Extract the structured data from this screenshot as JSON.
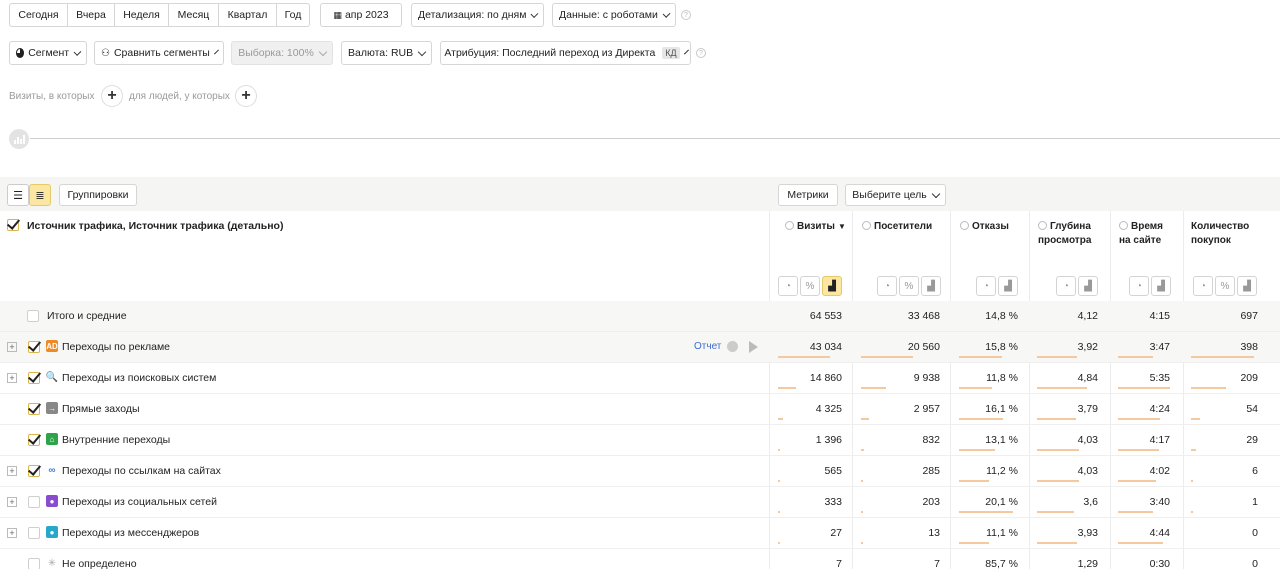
{
  "period_buttons": [
    "Сегодня",
    "Вчера",
    "Неделя",
    "Месяц",
    "Квартал",
    "Год"
  ],
  "date_picker": "апр 2023",
  "detail_label": "Детализация: по дням",
  "data_label": "Данные: с роботами",
  "segment_label": "Сегмент",
  "compare_label": "Сравнить сегменты",
  "sample_label": "Выборка: 100%",
  "currency_label": "Валюта: RUB",
  "attribution_label": "Атрибуция: Последний переход из Директа",
  "attribution_badge": "КД",
  "filter_visits": "Визиты, в которых",
  "filter_people": "для людей, у которых",
  "groupings_label": "Группировки",
  "metrics_label": "Метрики",
  "goal_label": "Выберите цель",
  "table": {
    "dimension_header": "Источник трафика, Источник трафика (детально)",
    "columns": [
      {
        "name": "Визиты",
        "sorted": true
      },
      {
        "name": "Посетители"
      },
      {
        "name": "Отказы"
      },
      {
        "name": "Глубина просмотра",
        "l1": "Глубина",
        "l2": "просмотра"
      },
      {
        "name": "Время на сайте",
        "l1": "Время",
        "l2": "на сайте"
      },
      {
        "name": "Количество покупок",
        "l1": "Количество",
        "l2": "покупок"
      }
    ],
    "sort_marker": "▼",
    "totals": {
      "label": "Итого и средние",
      "values": [
        "64 553",
        "33 468",
        "14,8 %",
        "4,12",
        "4:15",
        "697"
      ]
    },
    "report_link": "Отчет",
    "rows": [
      {
        "label": "Переходы по рекламе",
        "icon": "ad-icon",
        "icon_color": "#f08a24",
        "checked": true,
        "expand": false,
        "values": [
          "43 034",
          "20 560",
          "15,8 %",
          "3,92",
          "3:47",
          "398"
        ],
        "bar_fractions": [
          0.667,
          0.614,
          0.65,
          0.63,
          0.6,
          0.9
        ]
      },
      {
        "label": "Переходы из поисковых систем",
        "icon": "search-icon",
        "icon_color": "#e5533d",
        "checked": true,
        "expand": true,
        "values": [
          "14 860",
          "9 938",
          "11,8 %",
          "4,84",
          "5:35",
          "209"
        ],
        "bar_fractions": [
          0.23,
          0.3,
          0.5,
          0.78,
          0.9,
          0.5
        ]
      },
      {
        "label": "Прямые заходы",
        "icon": "arrow-icon",
        "icon_color": "#888888",
        "checked": true,
        "expand": false,
        "values": [
          "4 325",
          "2 957",
          "16,1 %",
          "3,79",
          "4:24",
          "54"
        ],
        "bar_fractions": [
          0.07,
          0.09,
          0.66,
          0.61,
          0.72,
          0.13
        ]
      },
      {
        "label": "Внутренние переходы",
        "icon": "home-icon",
        "icon_color": "#2ea34a",
        "checked": true,
        "expand": false,
        "values": [
          "1 396",
          "832",
          "13,1 %",
          "4,03",
          "4:17",
          "29"
        ],
        "bar_fractions": [
          0.03,
          0.03,
          0.54,
          0.65,
          0.7,
          0.07
        ]
      },
      {
        "label": "Переходы по ссылкам на сайтах",
        "icon": "link-icon",
        "icon_color": "#3b7dd8",
        "checked": true,
        "expand": true,
        "values": [
          "565",
          "285",
          "11,2 %",
          "4,03",
          "4:02",
          "6"
        ],
        "bar_fractions": [
          0.01,
          0.01,
          0.46,
          0.65,
          0.66,
          0.02
        ]
      },
      {
        "label": "Переходы из социальных сетей",
        "icon": "person-icon",
        "icon_color": "#8a4ccf",
        "checked": false,
        "expand": true,
        "values": [
          "333",
          "203",
          "20,1 %",
          "3,6",
          "3:40",
          "1"
        ],
        "bar_fractions": [
          0.01,
          0.01,
          0.82,
          0.58,
          0.6,
          0.01
        ]
      },
      {
        "label": "Переходы из мессенджеров",
        "icon": "chat-icon",
        "icon_color": "#27a7c9",
        "checked": false,
        "expand": true,
        "values": [
          "27",
          "13",
          "11,1 %",
          "3,93",
          "4:44",
          "0"
        ],
        "bar_fractions": [
          0.01,
          0.01,
          0.45,
          0.63,
          0.77,
          0
        ]
      },
      {
        "label": "Не определено",
        "icon": "sparkle-icon",
        "icon_color": "#aaaaaa",
        "checked": false,
        "expand": false,
        "values": [
          "7",
          "7",
          "85,7 %",
          "1,29",
          "0:30",
          "0"
        ],
        "bar_fractions": [
          0,
          0,
          0,
          0,
          0,
          0
        ]
      }
    ]
  }
}
